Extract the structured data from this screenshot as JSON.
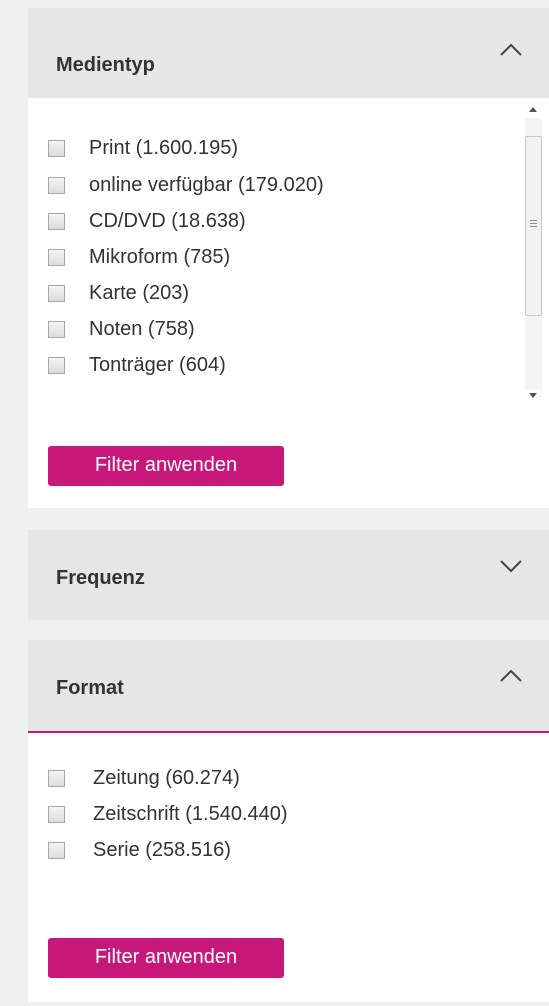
{
  "medientyp": {
    "title": "Medientyp",
    "expanded": true,
    "options": [
      {
        "label": "Print (1.600.195)",
        "checked": false
      },
      {
        "label": "online verfügbar (179.020)",
        "checked": false
      },
      {
        "label": "CD/DVD (18.638)",
        "checked": false
      },
      {
        "label": "Mikroform (785)",
        "checked": false
      },
      {
        "label": "Karte (203)",
        "checked": false
      },
      {
        "label": "Noten (758)",
        "checked": false
      },
      {
        "label": "Tonträger (604)",
        "checked": false
      }
    ],
    "apply_label": "Filter anwenden",
    "header_icon": "chevron-up-icon"
  },
  "frequenz": {
    "title": "Frequenz",
    "expanded": false,
    "header_icon": "chevron-down-icon"
  },
  "format": {
    "title": "Format",
    "expanded": true,
    "options": [
      {
        "label": "Zeitung (60.274)",
        "checked": false
      },
      {
        "label": "Zeitschrift (1.540.440)",
        "checked": false
      },
      {
        "label": "Serie (258.516)",
        "checked": false
      }
    ],
    "apply_label": "Filter anwenden",
    "header_icon": "chevron-up-icon"
  },
  "colors": {
    "accent": "#c8177a",
    "header_bg": "#e6e6e6",
    "page_bg": "#f0f0f0"
  }
}
